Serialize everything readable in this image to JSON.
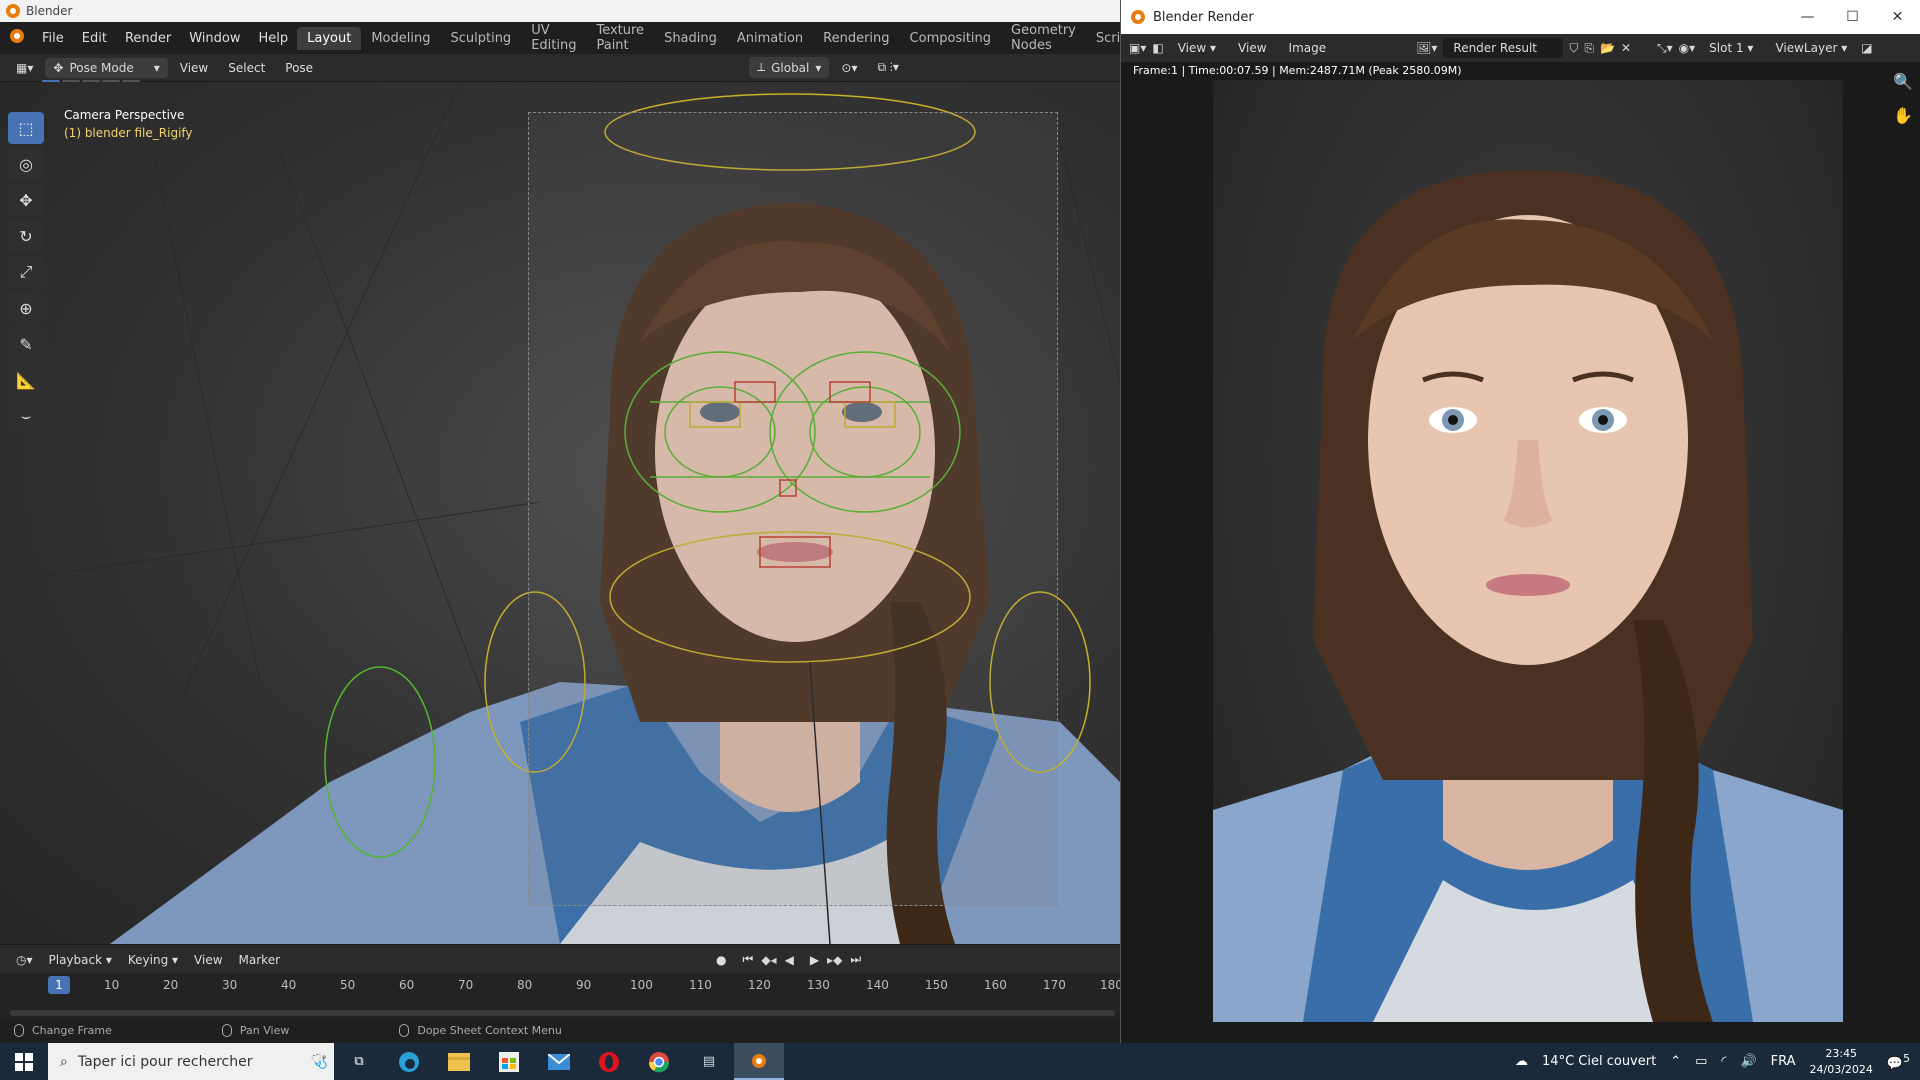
{
  "main_window": {
    "title": "Blender",
    "menu": [
      "File",
      "Edit",
      "Render",
      "Window",
      "Help"
    ],
    "workspaces": [
      "Layout",
      "Modeling",
      "Sculpting",
      "UV Editing",
      "Texture Paint",
      "Shading",
      "Animation",
      "Rendering",
      "Compositing",
      "Geometry Nodes",
      "Scripting"
    ],
    "active_workspace": "Layout",
    "add_workspace": "+",
    "header": {
      "mode": "Pose Mode",
      "view": "View",
      "select": "Select",
      "pose": "Pose",
      "orientation": "Global"
    },
    "viewport": {
      "title": "Camera Perspective",
      "subtitle": "(1) blender file_Rigify"
    },
    "timeline": {
      "playback": "Playback",
      "keying": "Keying",
      "view": "View",
      "marker": "Marker",
      "current_frame": "1",
      "ticks": [
        "10",
        "20",
        "30",
        "40",
        "50",
        "60",
        "70",
        "80",
        "90",
        "100",
        "110",
        "120",
        "130",
        "140",
        "150",
        "160",
        "170",
        "180"
      ]
    },
    "status": [
      "Change Frame",
      "Pan View",
      "Dope Sheet Context Menu"
    ]
  },
  "render_window": {
    "title": "Blender Render",
    "menu_view": "View",
    "menu_view2": "View",
    "menu_image": "Image",
    "image_name": "Render Result",
    "slot": "Slot 1",
    "layer": "ViewLayer",
    "info": "Frame:1 | Time:00:07.59 | Mem:2487.71M (Peak 2580.09M)"
  },
  "taskbar": {
    "search_placeholder": "Taper ici pour rechercher",
    "weather": "14°C  Ciel couvert",
    "lang": "FRA",
    "time": "23:45",
    "date": "24/03/2024",
    "notif": "5"
  }
}
